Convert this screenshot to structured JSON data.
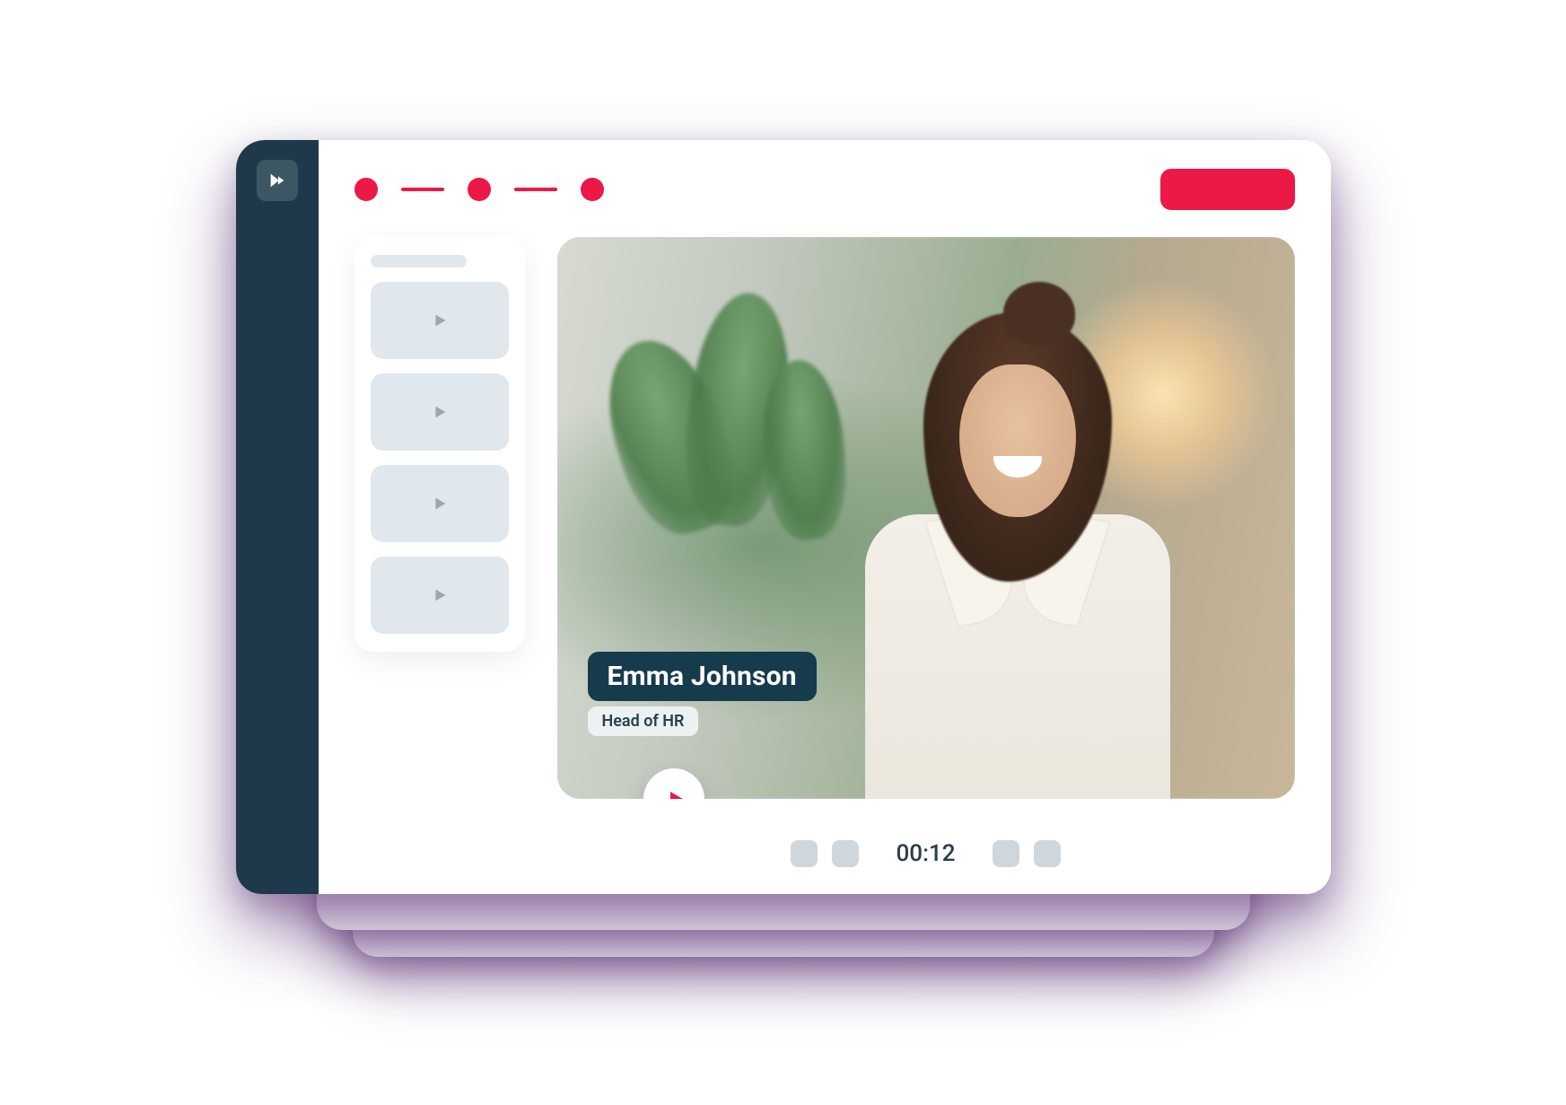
{
  "colors": {
    "accent": "#ec1846",
    "rail": "#1e3a4a",
    "thumb_bg": "#e0e8ee",
    "ctrl_bg": "#cfd7dd",
    "lt_name_bg": "#163b4d",
    "lt_role_bg": "#eef1f1"
  },
  "topbar": {
    "steps_completed": 3,
    "cta_label": ""
  },
  "clips": {
    "count": 4
  },
  "video": {
    "lower_third": {
      "name": "Emma Johnson",
      "role": "Head of HR"
    },
    "timecode": "00:12"
  }
}
